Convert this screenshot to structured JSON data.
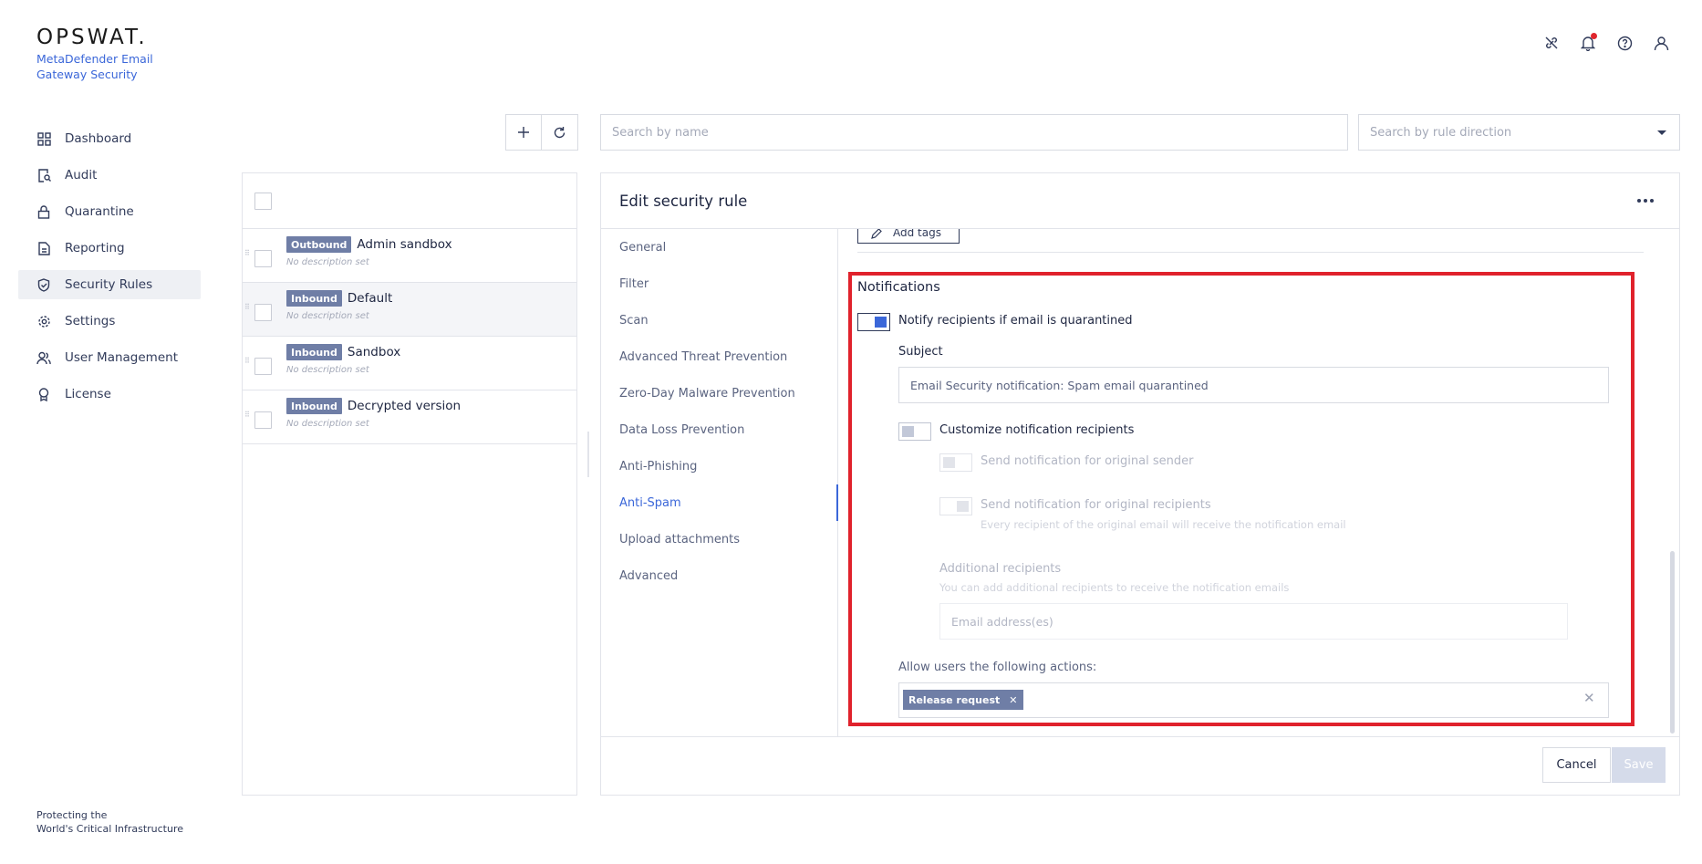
{
  "brand": {
    "logo": "OPSWAT.",
    "product": "MetaDefender Email Gateway Security"
  },
  "sidebar": {
    "items": [
      {
        "label": "Dashboard",
        "icon": "dashboard-icon"
      },
      {
        "label": "Audit",
        "icon": "audit-icon"
      },
      {
        "label": "Quarantine",
        "icon": "lock-icon"
      },
      {
        "label": "Reporting",
        "icon": "document-icon"
      },
      {
        "label": "Security Rules",
        "icon": "shield-check-icon",
        "active": true
      },
      {
        "label": "Settings",
        "icon": "gear-icon"
      },
      {
        "label": "User Management",
        "icon": "users-icon"
      },
      {
        "label": "License",
        "icon": "license-icon"
      }
    ],
    "footer_line1": "Protecting the",
    "footer_line2": "World's Critical Infrastructure"
  },
  "header_icons": [
    "link-off-icon",
    "bell-icon",
    "help-icon",
    "user-icon"
  ],
  "search": {
    "name_placeholder": "Search by name",
    "direction_placeholder": "Search by rule direction"
  },
  "rules": [
    {
      "direction": "Outbound",
      "name": "Admin sandbox",
      "description": "No description set"
    },
    {
      "direction": "Inbound",
      "name": "Default",
      "description": "No description set",
      "selected": true
    },
    {
      "direction": "Inbound",
      "name": "Sandbox",
      "description": "No description set"
    },
    {
      "direction": "Inbound",
      "name": "Decrypted version",
      "description": "No description set"
    }
  ],
  "edit": {
    "title": "Edit security rule",
    "sections": [
      "General",
      "Filter",
      "Scan",
      "Advanced Threat Prevention",
      "Zero-Day Malware Prevention",
      "Data Loss Prevention",
      "Anti-Phishing",
      "Anti-Spam",
      "Upload attachments",
      "Advanced"
    ],
    "active_section": "Anti-Spam",
    "add_tags_label": "Add tags",
    "cancel_label": "Cancel",
    "save_label": "Save"
  },
  "notifications": {
    "title": "Notifications",
    "notify_label": "Notify recipients if email is quarantined",
    "notify_on": true,
    "subject_label": "Subject",
    "subject_value": "Email Security notification: Spam email quarantined",
    "customize_label": "Customize notification recipients",
    "customize_on": false,
    "original_sender_label": "Send notification for original sender",
    "original_recipients_label": "Send notification for original recipients",
    "original_recipients_hint": "Every recipient of the original email will receive the notification email",
    "additional_label": "Additional recipients",
    "additional_hint": "You can add additional recipients to receive the notification emails",
    "email_placeholder": "Email address(es)",
    "actions_label": "Allow users the following actions:",
    "actions": [
      "Release request"
    ]
  },
  "colors": {
    "accent": "#3b67d9",
    "badge": "#6f7ea6",
    "highlight": "#e0222c"
  }
}
